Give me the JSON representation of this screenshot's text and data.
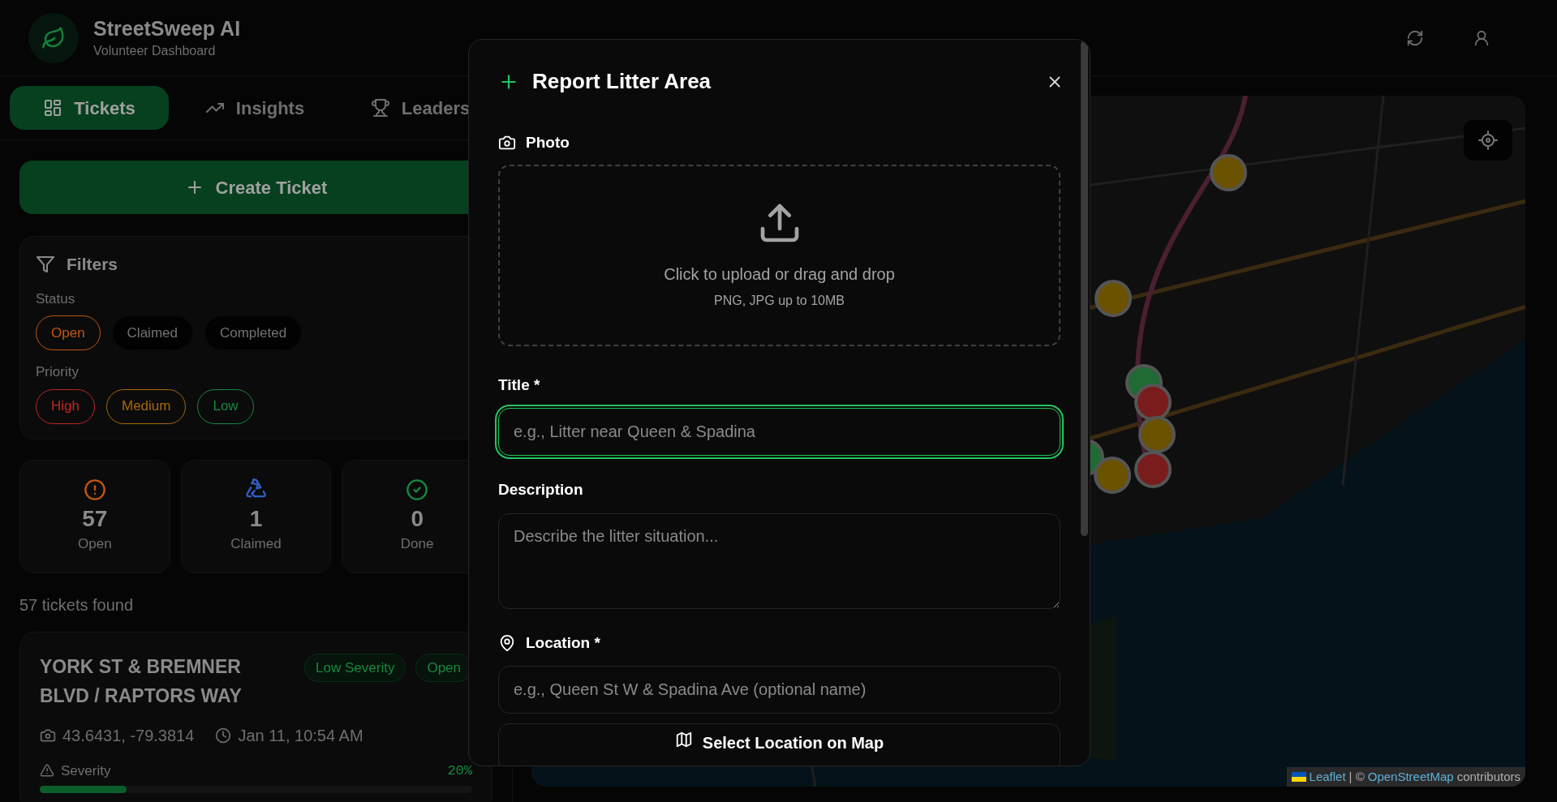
{
  "header": {
    "title": "StreetSweep AI",
    "subtitle": "Volunteer Dashboard"
  },
  "tabs": [
    {
      "label": "Tickets",
      "selected": true
    },
    {
      "label": "Insights",
      "selected": false
    },
    {
      "label": "Leaders",
      "selected": false
    }
  ],
  "create_button": "Create Ticket",
  "filters": {
    "title": "Filters",
    "groups": [
      {
        "label": "Status",
        "chips": [
          {
            "label": "Open",
            "selected": true,
            "color": "#c2560f"
          },
          {
            "label": "Claimed",
            "selected": false,
            "color": "#737373"
          },
          {
            "label": "Completed",
            "selected": false,
            "color": "#737373"
          }
        ]
      },
      {
        "label": "Priority",
        "chips": [
          {
            "label": "High",
            "selected": true,
            "color": "#c02626"
          },
          {
            "label": "Medium",
            "selected": true,
            "color": "#a86a06"
          },
          {
            "label": "Low",
            "selected": true,
            "color": "#16893f"
          }
        ]
      }
    ]
  },
  "stats": [
    {
      "value": "57",
      "label": "Open",
      "color": "#c2560f"
    },
    {
      "value": "1",
      "label": "Claimed",
      "color": "#2f5fc4"
    },
    {
      "value": "0",
      "label": "Done",
      "color": "#16893f"
    }
  ],
  "results_count": "57 tickets found",
  "tickets": [
    {
      "title": "YORK ST & BREMNER BLVD / RAPTORS WAY",
      "badges": [
        {
          "label": "Low Severity",
          "color": "#16893f"
        },
        {
          "label": "Open",
          "color": "#16893f"
        }
      ],
      "coordinates": "43.6431, -79.3814",
      "time": "Jan 11, 10:54 AM",
      "severity_label": "Severity",
      "severity_reading": "20%",
      "level": 0.2
    }
  ],
  "map": {
    "markers": [
      {
        "color": "#6b5200"
      },
      {
        "color": "#6b5200"
      },
      {
        "color": "#1f6b33"
      },
      {
        "color": "#1f6b33"
      },
      {
        "color": "#7a1c1c"
      },
      {
        "color": "#6b5200"
      },
      {
        "color": "#7a1c1c"
      },
      {
        "color": "#6b5200"
      }
    ],
    "attribution": [
      {
        "kind": "link",
        "text": "Leaflet"
      },
      {
        "kind": "text",
        "text": "| ©"
      },
      {
        "kind": "link",
        "text": "OpenStreetMap"
      },
      {
        "kind": "text",
        "text": "contributors"
      }
    ]
  },
  "modal": {
    "title": "Report Litter Area",
    "photo_label": "Photo",
    "upload_text": "Click to upload or drag and drop",
    "upload_hint": "PNG, JPG up to 10MB",
    "fields": [
      {
        "kind": "input",
        "label": "Title *",
        "placeholder": "e.g., Litter near Queen & Spadina",
        "focused": true
      },
      {
        "kind": "textarea",
        "label": "Description",
        "placeholder": "Describe the litter situation...",
        "focused": false
      },
      {
        "kind": "location",
        "label": "Location *",
        "placeholder": "e.g., Queen St W & Spadina Ave (optional name)",
        "focused": false
      }
    ],
    "select_button": "Select Location on Map"
  }
}
